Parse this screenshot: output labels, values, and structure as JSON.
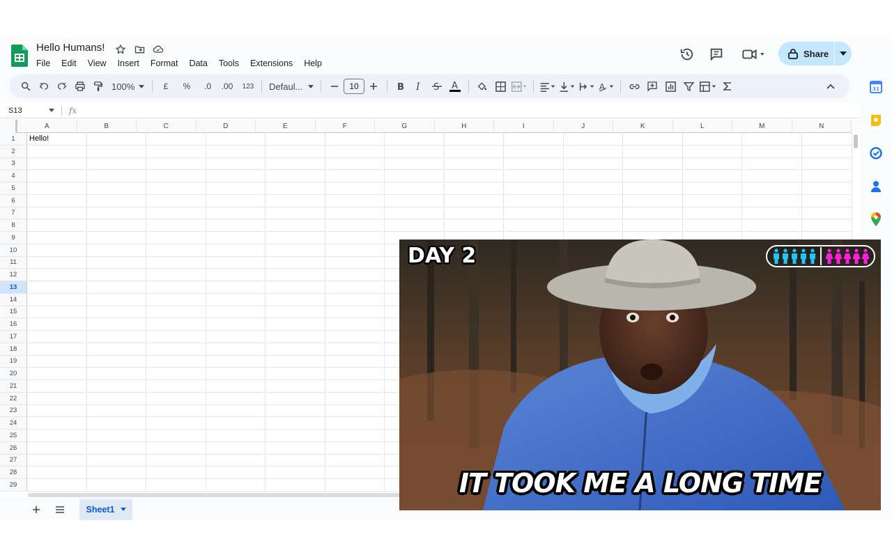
{
  "document": {
    "title": "Hello Humans!",
    "menu": [
      "File",
      "Edit",
      "View",
      "Insert",
      "Format",
      "Data",
      "Tools",
      "Extensions",
      "Help"
    ],
    "share_label": "Share"
  },
  "toolbar": {
    "zoom": "100%",
    "currency": "£",
    "percent": "%",
    "decrease_decimal": ".0",
    "increase_decimal": ".00",
    "more_formats": "123",
    "font": "Defaul...",
    "font_size": "10"
  },
  "formula_bar": {
    "cell_ref": "S13",
    "fx": "fx",
    "value": ""
  },
  "grid": {
    "columns": [
      "A",
      "B",
      "C",
      "D",
      "E",
      "F",
      "G",
      "H",
      "I",
      "J",
      "K",
      "L",
      "M",
      "N"
    ],
    "rows": [
      "1",
      "2",
      "3",
      "4",
      "5",
      "6",
      "7",
      "8",
      "9",
      "10",
      "11",
      "12",
      "13",
      "14",
      "15",
      "16",
      "17",
      "18",
      "19",
      "20",
      "21",
      "22",
      "23",
      "24",
      "25",
      "26",
      "27",
      "28",
      "29"
    ],
    "selected_row": "13",
    "cells": {
      "A1": "Hello!"
    }
  },
  "sheets": {
    "tabs": [
      "Sheet1"
    ],
    "active": "Sheet1"
  },
  "side_panel": {
    "icons": [
      "calendar-icon",
      "keep-icon",
      "tasks-icon",
      "contacts-icon",
      "maps-icon"
    ],
    "calendar_day": "31"
  },
  "video": {
    "caption_top": "DAY 2",
    "caption_bottom": "IT TOOK ME A LONG TIME",
    "counter": {
      "male": 5,
      "female": 5,
      "male_color": "#22c4f0",
      "female_color": "#ff1fd7"
    }
  },
  "colors": {
    "accent": "#0b57d0",
    "share_bg": "#c2e7ff",
    "toolbar_bg": "#edf2fa",
    "sheets_green": "#0f9d58"
  }
}
